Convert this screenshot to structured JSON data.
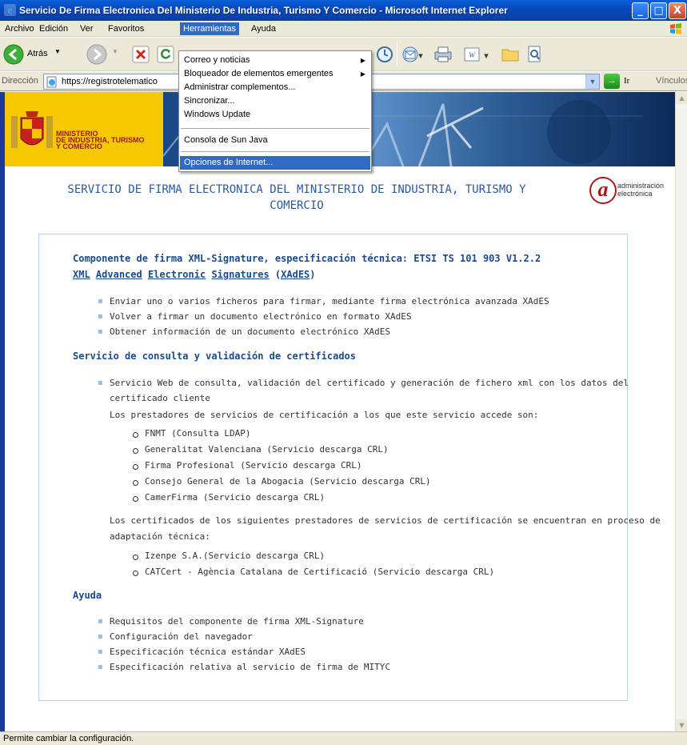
{
  "window": {
    "title": "Servicio De Firma Electronica Del Ministerio De Industria, Turismo Y Comercio - Microsoft Internet Explorer",
    "minimize": "_",
    "maximize": "□",
    "close": "X"
  },
  "menubar": {
    "items": [
      "Archivo",
      "Edición",
      "Ver",
      "Favoritos",
      "Herramientas",
      "Ayuda"
    ],
    "active": "Herramientas"
  },
  "toolbar": {
    "back_label": "Atrás"
  },
  "addressbar": {
    "label": "Dirección",
    "url": "https://registrotelematico",
    "go_label": "Ir",
    "links_label": "Vínculos"
  },
  "dropdown": {
    "items": [
      {
        "label": "Correo y noticias",
        "submenu": true
      },
      {
        "label": "Bloqueador de elementos emergentes",
        "submenu": true
      },
      {
        "label": "Administrar complementos...",
        "submenu": false
      },
      {
        "label": "Sincronizar...",
        "submenu": false
      },
      {
        "label": "Windows Update",
        "submenu": false
      },
      {
        "label": "Consola de Sun Java",
        "submenu": false
      },
      {
        "label": "Opciones de Internet...",
        "submenu": false,
        "highlighted": true
      }
    ]
  },
  "banner": {
    "ministry_lines": [
      "MINISTERIO",
      "DE INDUSTRIA, TURISMO",
      "Y COMERCIO"
    ]
  },
  "page": {
    "title_line1": "SERVICIO DE FIRMA ELECTRONICA DEL MINISTERIO DE INDUSTRIA, TURISMO Y",
    "title_line2": "COMERCIO",
    "admin_logo": {
      "symbol": "a",
      "line1": "administración",
      "line2": "electrónica"
    }
  },
  "sections": {
    "xades": {
      "title_line1": "Componente de firma XML-Signature, especificación técnica: ETSI TS 101 903 V1.2.2",
      "title_line2_parts": [
        "XML",
        "Advanced",
        "Electronic",
        "Signatures",
        "XAdES"
      ],
      "items": [
        "Enviar uno o varios ficheros para firmar, mediante firma electrónica avanzada XAdES",
        "Volver a firmar un documento electrónico en formato XAdES",
        "Obtener información de un documento electrónico XAdES"
      ]
    },
    "consulta": {
      "title": "Servicio de consulta y validación de certificados",
      "item_line1": "Servicio Web de consulta, validación del certificado y generación de fichero xml con los datos del",
      "item_line2": "certificado cliente",
      "prestadores_intro": "Los prestadores de servicios de certificación a los que este servicio accede son:",
      "prestadores": [
        "FNMT (Consulta LDAP)",
        "Generalitat Valenciana (Servicio descarga CRL)",
        "Firma Profesional (Servicio descarga CRL)",
        "Consejo General de la Abogacia (Servicio descarga CRL)",
        "CamerFirma (Servicio descarga CRL)"
      ],
      "adaptacion_line1": "Los certificados de los siguientes prestadores de servicios de certificación se encuentran en proceso de",
      "adaptacion_line2": "adaptación técnica:",
      "adaptacion": [
        "Izenpe S.A.(Servicio descarga CRL)",
        "CATCert - Agència Catalana de Certificació (Servicio descarga CRL)"
      ]
    },
    "ayuda": {
      "title": "Ayuda",
      "items": [
        "Requisitos del componente de firma XML-Signature",
        "Configuración del navegador",
        "Especificación técnica estándar XAdES",
        "Especificación relativa al servicio de firma de MITYC"
      ]
    }
  },
  "statusbar": {
    "text": "Permite cambiar la configuración."
  },
  "colors": {
    "titlebar": "#0648b8",
    "menu_highlight": "#316ac5",
    "section_title": "#1a4b8c",
    "page_title": "#2a5a9c",
    "banner_yellow": "#f6c800"
  }
}
